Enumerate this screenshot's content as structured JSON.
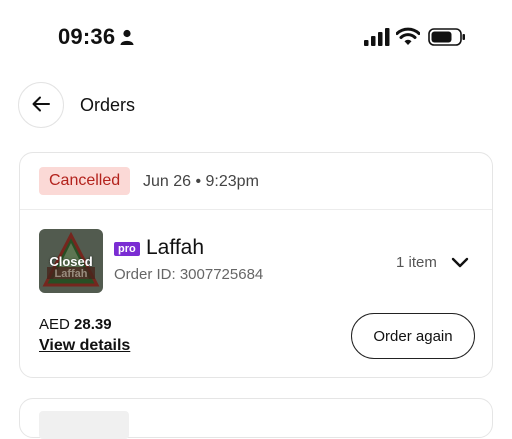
{
  "status_bar": {
    "time": "09:36",
    "icons": [
      "person-icon",
      "signal-icon",
      "wifi-icon",
      "battery-icon"
    ]
  },
  "header": {
    "title": "Orders",
    "back_icon": "arrow-left-icon"
  },
  "order": {
    "status": "Cancelled",
    "date": "Jun 26 • 9:23pm",
    "restaurant": {
      "name": "Laffah",
      "badge": "pro",
      "logo_overlay": "Closed",
      "logo_text": "Laffah"
    },
    "order_id": "Order ID: 3007725684",
    "item_count": "1 item",
    "price": {
      "currency": "AED",
      "amount": "28.39"
    },
    "view_details_label": "View details",
    "order_again_label": "Order again"
  },
  "colors": {
    "status_badge_bg": "#fbd9d6",
    "status_badge_text": "#b3221c",
    "pro_badge": "#7b2dd3"
  }
}
